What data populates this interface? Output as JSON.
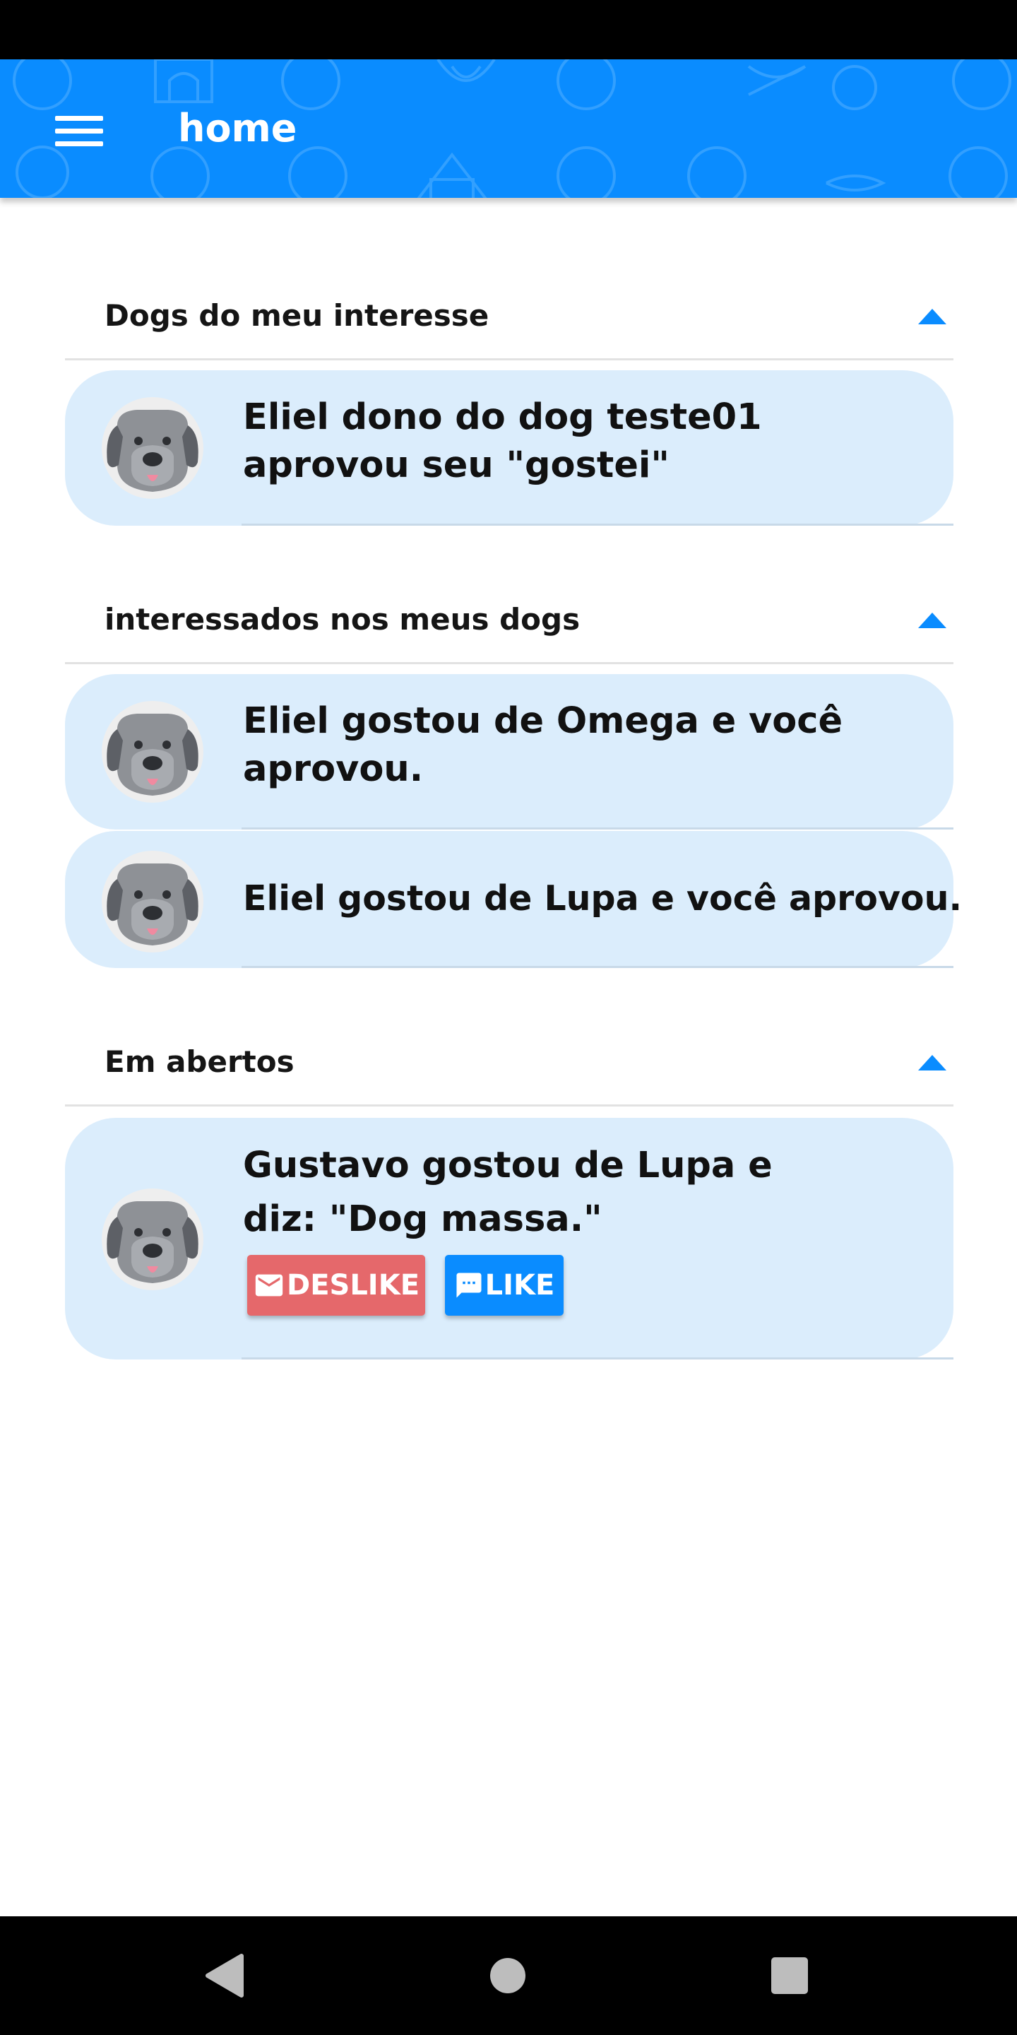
{
  "app_bar": {
    "title": "home",
    "color": "#0a8cff"
  },
  "sections": [
    {
      "title": "Dogs do meu interesse",
      "items": [
        {
          "text": "Eliel dono do dog teste01 aprovou seu \"gostei\""
        }
      ]
    },
    {
      "title": "interessados nos meus dogs",
      "items": [
        {
          "text": "Eliel gostou de Omega e você aprovou."
        },
        {
          "text": "Eliel gostou de Lupa e você aprovou."
        }
      ]
    },
    {
      "title": "Em abertos",
      "items": [
        {
          "text": "Gustavo gostou de Lupa e diz: \"Dog massa.\"",
          "buttons": [
            {
              "label": "DESLIKE",
              "icon": "mail-icon",
              "color": "#e5686b"
            },
            {
              "label": "LIKE",
              "icon": "message-icon",
              "color": "#0a8cff"
            }
          ]
        }
      ]
    }
  ],
  "icons": {
    "menu": "hamburger-menu-icon",
    "collapse": "caret-up-icon",
    "avatar": "dog-avatar-icon",
    "nav_back": "back-triangle-icon",
    "nav_home": "home-circle-icon",
    "nav_recents": "recents-square-icon"
  },
  "colors": {
    "card_background": "#dbedfc",
    "accent": "#0a8cff"
  }
}
